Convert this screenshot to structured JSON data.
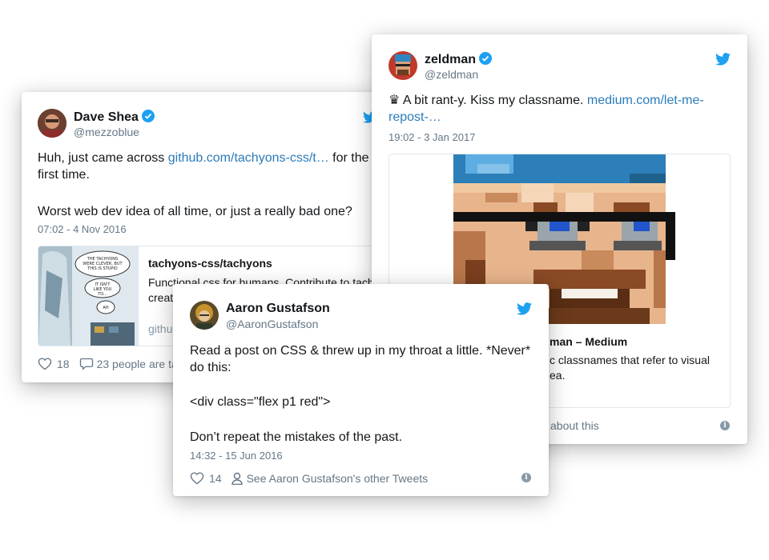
{
  "tweets": {
    "dave": {
      "name": "Dave Shea",
      "handle": "@mezzoblue",
      "text_before": "Huh, just came across ",
      "link": "github.com/tachyons-css/t…",
      "text_after": " for the first time.",
      "text2": "Worst web dev idea of all time, or just a really bad one?",
      "date": "07:02 - 4 Nov 2016",
      "card_title": "tachyons-css/tachyons",
      "card_desc": "Functional css for humans. Contribute to tachy",
      "card_desc2": "creati",
      "card_domain": "github",
      "comic_text_1": "THE TACHYONS WERE CLEVER, BUT THIS IS STUPID",
      "comic_text_2": "IT ISN'T LIKE YOU TO...",
      "comic_text_3": "AH",
      "likes": "18",
      "people_text": "23 people are ta"
    },
    "zeldman": {
      "name": "zeldman",
      "handle": "@zeldman",
      "crown": "♛",
      "text_before": " A bit rant-y. Kiss my classname.  ",
      "link": "medium.com/let-me-repost-…",
      "date": "19:02 - 3 Jan 2017",
      "card_title": "man – Medium",
      "card_desc": "c classnames that refer to visual",
      "card_desc2": "ea.",
      "talk_text": "about this"
    },
    "aaron": {
      "name": "Aaron Gustafson",
      "handle": "@AaronGustafson",
      "line1": "Read a post on CSS & threw up in my throat a little. *Never* do this:",
      "line2": "<div class=\"flex p1 red\">",
      "line3": "Don’t repeat the mistakes of the past.",
      "date": "14:32 - 15 Jun 2016",
      "likes": "14",
      "other_tweets": "See Aaron Gustafson's other Tweets"
    }
  },
  "icons": {
    "verified": "verified-badge-icon",
    "bird": "twitter-bird-icon",
    "heart": "heart-icon",
    "comment": "comment-bubble-icon",
    "person": "person-icon",
    "info": "info-icon"
  },
  "colors": {
    "twitter_blue": "#1da1f2",
    "link": "#2b7bb9",
    "meta": "#657786"
  }
}
